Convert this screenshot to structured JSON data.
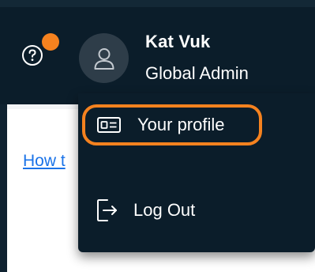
{
  "header": {
    "help": {
      "icon": "question-circle-icon",
      "notification_color": "#f5821f"
    },
    "user": {
      "avatar_icon": "user-icon",
      "name": "Kat Vuk",
      "role": "Global Admin"
    }
  },
  "content": {
    "link_text": "How t"
  },
  "dropdown": {
    "items": [
      {
        "label": "Your profile",
        "icon": "id-card-icon",
        "highlight_color": "#f5821f"
      },
      {
        "label": "Log Out",
        "icon": "logout-icon"
      }
    ]
  },
  "colors": {
    "header_bg": "#0b1d2a",
    "accent": "#f5821f",
    "link": "#1a73e8",
    "text": "#ffffff"
  }
}
